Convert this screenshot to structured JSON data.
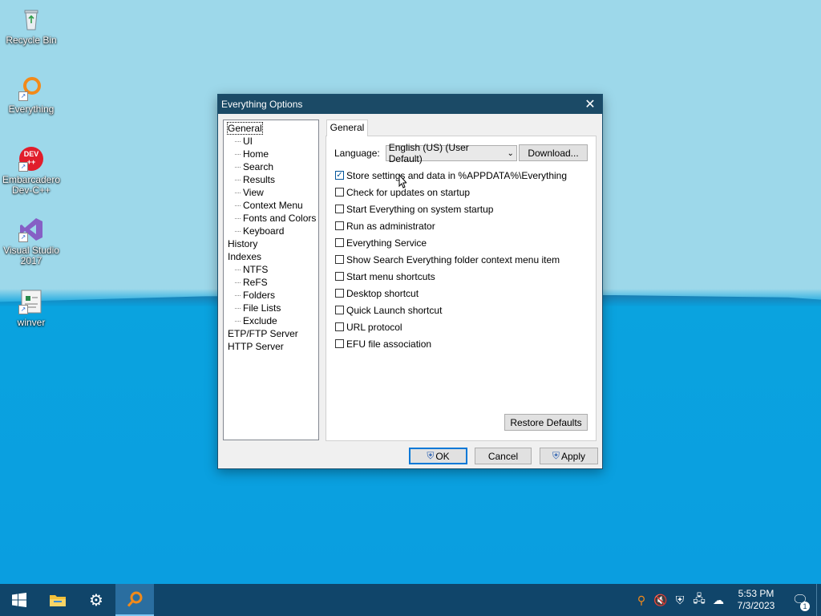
{
  "desktop": {
    "icons": [
      {
        "label": "Recycle Bin",
        "icon": "recycle-bin-icon"
      },
      {
        "label": "Everything",
        "icon": "everything-magnifier-icon"
      },
      {
        "label": "Embarcadero Dev-C++",
        "icon": "devcpp-icon",
        "badge_text": "DEV\n++"
      },
      {
        "label": "Visual Studio 2017",
        "icon": "visual-studio-icon"
      },
      {
        "label": "winver",
        "icon": "winver-icon"
      }
    ]
  },
  "dialog": {
    "title": "Everything Options",
    "tree": [
      {
        "label": "General",
        "level": 0,
        "selected": true
      },
      {
        "label": "UI",
        "level": 1
      },
      {
        "label": "Home",
        "level": 1
      },
      {
        "label": "Search",
        "level": 1
      },
      {
        "label": "Results",
        "level": 1
      },
      {
        "label": "View",
        "level": 1
      },
      {
        "label": "Context Menu",
        "level": 1
      },
      {
        "label": "Fonts and Colors",
        "level": 1
      },
      {
        "label": "Keyboard",
        "level": 1
      },
      {
        "label": "History",
        "level": 0
      },
      {
        "label": "Indexes",
        "level": 0
      },
      {
        "label": "NTFS",
        "level": 1
      },
      {
        "label": "ReFS",
        "level": 1
      },
      {
        "label": "Folders",
        "level": 1
      },
      {
        "label": "File Lists",
        "level": 1
      },
      {
        "label": "Exclude",
        "level": 1
      },
      {
        "label": "ETP/FTP Server",
        "level": 0
      },
      {
        "label": "HTTP Server",
        "level": 0
      }
    ],
    "tab_label": "General",
    "language_label": "Language:",
    "language_value": "English (US) (User Default)",
    "download_label": "Download...",
    "checkboxes": [
      {
        "label": "Store settings and data in %APPDATA%\\Everything",
        "checked": true
      },
      {
        "label": "Check for updates on startup",
        "checked": false
      },
      {
        "label": "Start Everything on system startup",
        "checked": false
      },
      {
        "label": "Run as administrator",
        "checked": false
      },
      {
        "label": "Everything Service",
        "checked": false
      },
      {
        "label": "Show Search Everything folder context menu item",
        "checked": false
      },
      {
        "label": "Start menu shortcuts",
        "checked": false
      },
      {
        "label": "Desktop shortcut",
        "checked": false
      },
      {
        "label": "Quick Launch shortcut",
        "checked": false
      },
      {
        "label": "URL protocol",
        "checked": false
      },
      {
        "label": "EFU file association",
        "checked": false
      }
    ],
    "restore_label": "Restore Defaults",
    "ok_label": "OK",
    "cancel_label": "Cancel",
    "apply_label": "Apply"
  },
  "taskbar": {
    "time": "5:53 PM",
    "date": "7/3/2023",
    "notification_count": "1",
    "buttons": [
      "start-windows-icon",
      "file-explorer-icon",
      "settings-gear-icon",
      "everything-magnifier-icon"
    ],
    "tray_icons": [
      "everything-tray-icon",
      "volume-muted-icon",
      "security-shield-icon",
      "network-icon",
      "onedrive-cloud-icon"
    ]
  },
  "colors": {
    "titlebar": "#1b4a66",
    "taskbar": "#10456a",
    "accent": "#0078d7"
  }
}
